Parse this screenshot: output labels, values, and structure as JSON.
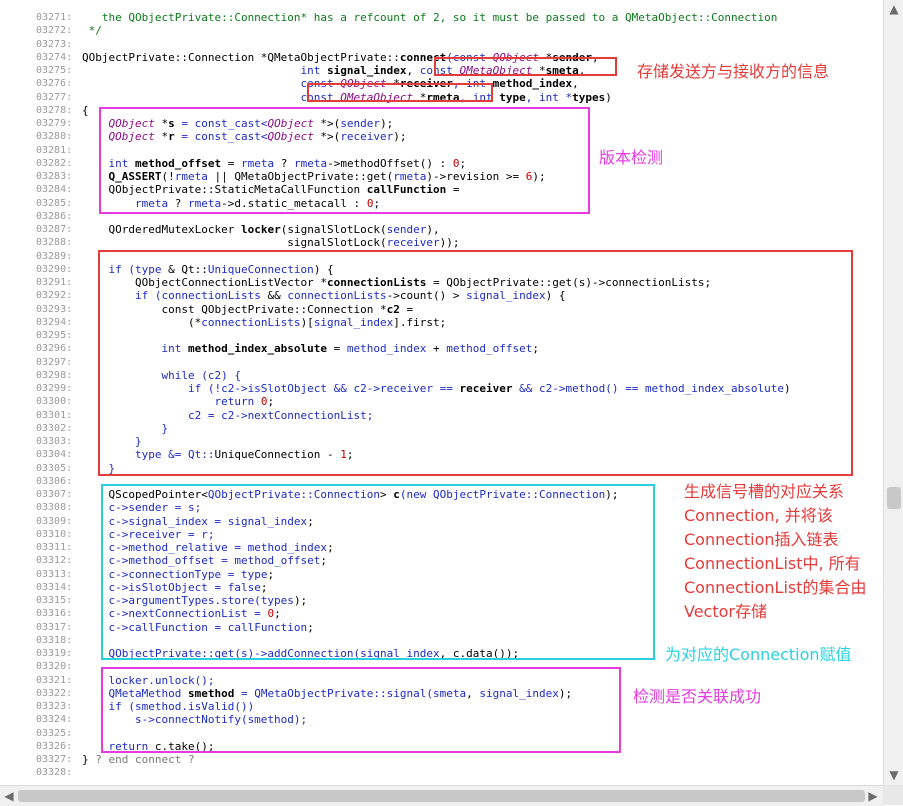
{
  "code_lines": [
    {
      "ln": "03271:",
      "segments": [
        {
          "t": "   the QObjectPrivate::Connection* has a refcount of 2, so it must be passed to a QMetaObject::Connection",
          "c": "cm"
        }
      ]
    },
    {
      "ln": "03272:",
      "segments": [
        {
          "t": " */",
          "c": "cm"
        }
      ]
    },
    {
      "ln": "03273:",
      "segments": []
    },
    {
      "ln": "03274:",
      "segments": [
        {
          "t": "QObjectPrivate::Connection *QMetaObjectPrivate::",
          "c": "id"
        },
        {
          "t": "connect",
          "c": "fn"
        },
        {
          "t": "(const ",
          "c": "kw"
        },
        {
          "t": "QObject",
          "c": "ty"
        },
        {
          "t": " *",
          "c": "id"
        },
        {
          "t": "sender",
          "c": "fn"
        },
        {
          "t": ",",
          "c": "id"
        }
      ]
    },
    {
      "ln": "03275:",
      "segments": [
        {
          "t": "                                 int ",
          "c": "kw"
        },
        {
          "t": "signal_index",
          "c": "fn"
        },
        {
          "t": ", ",
          "c": "id"
        },
        {
          "t": "const ",
          "c": "kw"
        },
        {
          "t": "QMetaObject",
          "c": "ty"
        },
        {
          "t": " *",
          "c": "id"
        },
        {
          "t": "smeta",
          "c": "fn"
        },
        {
          "t": ",",
          "c": "id"
        }
      ]
    },
    {
      "ln": "03276:",
      "segments": [
        {
          "t": "                                 const ",
          "c": "kw"
        },
        {
          "t": "QObject",
          "c": "ty"
        },
        {
          "t": " *",
          "c": "id"
        },
        {
          "t": "receiver",
          "c": "fn"
        },
        {
          "t": ", int ",
          "c": "kw"
        },
        {
          "t": "method_index",
          "c": "fn"
        },
        {
          "t": ",",
          "c": "id"
        }
      ]
    },
    {
      "ln": "03277:",
      "segments": [
        {
          "t": "                                 const ",
          "c": "kw"
        },
        {
          "t": "QMetaObject",
          "c": "ty"
        },
        {
          "t": " *",
          "c": "id"
        },
        {
          "t": "rmeta",
          "c": "fn"
        },
        {
          "t": ", int ",
          "c": "kw"
        },
        {
          "t": "type",
          "c": "fn"
        },
        {
          "t": ", int *",
          "c": "kw"
        },
        {
          "t": "types",
          "c": "fn"
        },
        {
          "t": ")",
          "c": "id"
        }
      ]
    },
    {
      "ln": "03278:",
      "segments": [
        {
          "t": "{",
          "c": "id"
        }
      ]
    },
    {
      "ln": "03279:",
      "segments": [
        {
          "t": "    ",
          "c": "id"
        },
        {
          "t": "QObject",
          "c": "ty"
        },
        {
          "t": " *",
          "c": "id"
        },
        {
          "t": "s",
          "c": "fn"
        },
        {
          "t": " = const_cast<",
          "c": "kw"
        },
        {
          "t": "QObject",
          "c": "ty"
        },
        {
          "t": " *>(",
          "c": "id"
        },
        {
          "t": "sender",
          "c": "kw"
        },
        {
          "t": ");",
          "c": "id"
        }
      ]
    },
    {
      "ln": "03280:",
      "segments": [
        {
          "t": "    ",
          "c": "id"
        },
        {
          "t": "QObject",
          "c": "ty"
        },
        {
          "t": " *",
          "c": "id"
        },
        {
          "t": "r",
          "c": "fn"
        },
        {
          "t": " = const_cast<",
          "c": "kw"
        },
        {
          "t": "QObject",
          "c": "ty"
        },
        {
          "t": " *>(",
          "c": "id"
        },
        {
          "t": "receiver",
          "c": "kw"
        },
        {
          "t": ");",
          "c": "id"
        }
      ]
    },
    {
      "ln": "03281:",
      "segments": []
    },
    {
      "ln": "03282:",
      "segments": [
        {
          "t": "    int ",
          "c": "kw"
        },
        {
          "t": "method_offset",
          "c": "fn"
        },
        {
          "t": " = ",
          "c": "id"
        },
        {
          "t": "rmeta",
          "c": "kw"
        },
        {
          "t": " ? ",
          "c": "id"
        },
        {
          "t": "rmeta",
          "c": "kw"
        },
        {
          "t": "->methodOffset() : ",
          "c": "id"
        },
        {
          "t": "0",
          "c": "num"
        },
        {
          "t": ";",
          "c": "id"
        }
      ]
    },
    {
      "ln": "03283:",
      "segments": [
        {
          "t": "    ",
          "c": "id"
        },
        {
          "t": "Q_ASSERT",
          "c": "fn"
        },
        {
          "t": "(!",
          "c": "id"
        },
        {
          "t": "rmeta",
          "c": "kw"
        },
        {
          "t": " || QMetaObjectPrivate::get(",
          "c": "id"
        },
        {
          "t": "rmeta",
          "c": "kw"
        },
        {
          "t": ")->revision >= ",
          "c": "id"
        },
        {
          "t": "6",
          "c": "num"
        },
        {
          "t": ");",
          "c": "id"
        }
      ]
    },
    {
      "ln": "03284:",
      "segments": [
        {
          "t": "    QObjectPrivate::StaticMetaCallFunction ",
          "c": "id"
        },
        {
          "t": "callFunction",
          "c": "fn"
        },
        {
          "t": " =",
          "c": "id"
        }
      ]
    },
    {
      "ln": "03285:",
      "segments": [
        {
          "t": "        ",
          "c": "id"
        },
        {
          "t": "rmeta",
          "c": "kw"
        },
        {
          "t": " ? ",
          "c": "id"
        },
        {
          "t": "rmeta",
          "c": "kw"
        },
        {
          "t": "->d.static_metacall : ",
          "c": "id"
        },
        {
          "t": "0",
          "c": "num"
        },
        {
          "t": ";",
          "c": "id"
        }
      ]
    },
    {
      "ln": "03286:",
      "segments": []
    },
    {
      "ln": "03287:",
      "segments": [
        {
          "t": "    QOrderedMutexLocker ",
          "c": "id"
        },
        {
          "t": "locker",
          "c": "fn"
        },
        {
          "t": "(signalSlotLock(",
          "c": "id"
        },
        {
          "t": "sender",
          "c": "kw"
        },
        {
          "t": "),",
          "c": "id"
        }
      ]
    },
    {
      "ln": "03288:",
      "segments": [
        {
          "t": "                               signalSlotLock(",
          "c": "id"
        },
        {
          "t": "receiver",
          "c": "kw"
        },
        {
          "t": "));",
          "c": "id"
        }
      ]
    },
    {
      "ln": "03289:",
      "segments": []
    },
    {
      "ln": "03290:",
      "segments": [
        {
          "t": "    if (",
          "c": "kw"
        },
        {
          "t": "type",
          "c": "kw"
        },
        {
          "t": " & Qt::",
          "c": "id"
        },
        {
          "t": "UniqueConnection",
          "c": "kw"
        },
        {
          "t": ") {",
          "c": "id"
        }
      ]
    },
    {
      "ln": "03291:",
      "segments": [
        {
          "t": "        QObjectConnectionListVector *",
          "c": "id"
        },
        {
          "t": "connectionLists",
          "c": "fn"
        },
        {
          "t": " = QObjectPrivate::get(s)->connectionLists;",
          "c": "id"
        }
      ]
    },
    {
      "ln": "03292:",
      "segments": [
        {
          "t": "        if (",
          "c": "kw"
        },
        {
          "t": "connectionLists",
          "c": "kw"
        },
        {
          "t": " && ",
          "c": "id"
        },
        {
          "t": "connectionLists",
          "c": "kw"
        },
        {
          "t": "->count() > ",
          "c": "id"
        },
        {
          "t": "signal_index",
          "c": "kw"
        },
        {
          "t": ") {",
          "c": "id"
        }
      ]
    },
    {
      "ln": "03293:",
      "segments": [
        {
          "t": "            const QObjectPrivate::Connection *",
          "c": "id"
        },
        {
          "t": "c2",
          "c": "fn"
        },
        {
          "t": " =",
          "c": "id"
        }
      ]
    },
    {
      "ln": "03294:",
      "segments": [
        {
          "t": "                (*",
          "c": "id"
        },
        {
          "t": "connectionLists",
          "c": "kw"
        },
        {
          "t": ")[",
          "c": "id"
        },
        {
          "t": "signal_index",
          "c": "kw"
        },
        {
          "t": "].first;",
          "c": "id"
        }
      ]
    },
    {
      "ln": "03295:",
      "segments": []
    },
    {
      "ln": "03296:",
      "segments": [
        {
          "t": "            int ",
          "c": "kw"
        },
        {
          "t": "method_index_absolute",
          "c": "fn"
        },
        {
          "t": " = ",
          "c": "id"
        },
        {
          "t": "method_index",
          "c": "kw"
        },
        {
          "t": " + ",
          "c": "id"
        },
        {
          "t": "method_offset",
          "c": "kw"
        },
        {
          "t": ";",
          "c": "id"
        }
      ]
    },
    {
      "ln": "03297:",
      "segments": []
    },
    {
      "ln": "03298:",
      "segments": [
        {
          "t": "            while (c2) {",
          "c": "kw"
        }
      ]
    },
    {
      "ln": "03299:",
      "segments": [
        {
          "t": "                if (!c2->isSlotObject && c2->receiver == ",
          "c": "kw"
        },
        {
          "t": "receiver",
          "c": "fn"
        },
        {
          "t": " && c2->method() == ",
          "c": "kw"
        },
        {
          "t": "method_index_absolute",
          "c": "kw"
        },
        {
          "t": ")",
          "c": "id"
        }
      ]
    },
    {
      "ln": "03300:",
      "segments": [
        {
          "t": "                    return ",
          "c": "kw"
        },
        {
          "t": "0",
          "c": "num"
        },
        {
          "t": ";",
          "c": "id"
        }
      ]
    },
    {
      "ln": "03301:",
      "segments": [
        {
          "t": "                c2 = c2->nextConnectionList;",
          "c": "kw"
        }
      ]
    },
    {
      "ln": "03302:",
      "segments": [
        {
          "t": "            }",
          "c": "kw"
        }
      ]
    },
    {
      "ln": "03303:",
      "segments": [
        {
          "t": "        }",
          "c": "kw"
        }
      ]
    },
    {
      "ln": "03304:",
      "segments": [
        {
          "t": "        type &= Qt::",
          "c": "kw"
        },
        {
          "t": "UniqueConnection",
          "c": "id"
        },
        {
          "t": " - ",
          "c": "id"
        },
        {
          "t": "1",
          "c": "num"
        },
        {
          "t": ";",
          "c": "id"
        }
      ]
    },
    {
      "ln": "03305:",
      "segments": [
        {
          "t": "    }",
          "c": "kw"
        }
      ]
    },
    {
      "ln": "03306:",
      "segments": []
    },
    {
      "ln": "03307:",
      "segments": [
        {
          "t": "    QScopedPointer<",
          "c": "id"
        },
        {
          "t": "QObjectPrivate::Connection",
          "c": "kw"
        },
        {
          "t": "> ",
          "c": "id"
        },
        {
          "t": "c",
          "c": "fn"
        },
        {
          "t": "(new ",
          "c": "kw"
        },
        {
          "t": "QObjectPrivate::Connection",
          "c": "kw"
        },
        {
          "t": ");",
          "c": "id"
        }
      ]
    },
    {
      "ln": "03308:",
      "segments": [
        {
          "t": "    c->sender = s;",
          "c": "kw"
        }
      ]
    },
    {
      "ln": "03309:",
      "segments": [
        {
          "t": "    c->signal_index = ",
          "c": "kw"
        },
        {
          "t": "signal_index",
          "c": "kw"
        },
        {
          "t": ";",
          "c": "id"
        }
      ]
    },
    {
      "ln": "03310:",
      "segments": [
        {
          "t": "    c->receiver = r;",
          "c": "kw"
        }
      ]
    },
    {
      "ln": "03311:",
      "segments": [
        {
          "t": "    c->method_relative = ",
          "c": "kw"
        },
        {
          "t": "method_index",
          "c": "kw"
        },
        {
          "t": ";",
          "c": "id"
        }
      ]
    },
    {
      "ln": "03312:",
      "segments": [
        {
          "t": "    c->method_offset = ",
          "c": "kw"
        },
        {
          "t": "method_offset",
          "c": "kw"
        },
        {
          "t": ";",
          "c": "id"
        }
      ]
    },
    {
      "ln": "03313:",
      "segments": [
        {
          "t": "    c->connectionType = ",
          "c": "kw"
        },
        {
          "t": "type",
          "c": "kw"
        },
        {
          "t": ";",
          "c": "id"
        }
      ]
    },
    {
      "ln": "03314:",
      "segments": [
        {
          "t": "    c->isSlotObject = ",
          "c": "kw"
        },
        {
          "t": "false",
          "c": "kw"
        },
        {
          "t": ";",
          "c": "id"
        }
      ]
    },
    {
      "ln": "03315:",
      "segments": [
        {
          "t": "    c->argumentTypes.store(",
          "c": "kw"
        },
        {
          "t": "types",
          "c": "kw"
        },
        {
          "t": ");",
          "c": "id"
        }
      ]
    },
    {
      "ln": "03316:",
      "segments": [
        {
          "t": "    c->nextConnectionList = ",
          "c": "kw"
        },
        {
          "t": "0",
          "c": "num"
        },
        {
          "t": ";",
          "c": "id"
        }
      ]
    },
    {
      "ln": "03317:",
      "segments": [
        {
          "t": "    c->callFunction = ",
          "c": "kw"
        },
        {
          "t": "callFunction",
          "c": "kw"
        },
        {
          "t": ";",
          "c": "id"
        }
      ]
    },
    {
      "ln": "03318:",
      "segments": []
    },
    {
      "ln": "03319:",
      "segments": [
        {
          "t": "    QObjectPrivate::get(s)->addConnection(",
          "c": "kw"
        },
        {
          "t": "signal_index",
          "c": "kw"
        },
        {
          "t": ", c.data());",
          "c": "id"
        }
      ]
    },
    {
      "ln": "03320:",
      "segments": []
    },
    {
      "ln": "03321:",
      "segments": [
        {
          "t": "    locker.unlock();",
          "c": "kw"
        }
      ]
    },
    {
      "ln": "03322:",
      "segments": [
        {
          "t": "    QMetaMethod ",
          "c": "kw"
        },
        {
          "t": "smethod",
          "c": "fn"
        },
        {
          "t": " = QMetaObjectPrivate::signal(",
          "c": "kw"
        },
        {
          "t": "smeta",
          "c": "kw"
        },
        {
          "t": ", ",
          "c": "id"
        },
        {
          "t": "signal_index",
          "c": "kw"
        },
        {
          "t": ");",
          "c": "id"
        }
      ]
    },
    {
      "ln": "03323:",
      "segments": [
        {
          "t": "    if (smethod.isValid())",
          "c": "kw"
        }
      ]
    },
    {
      "ln": "03324:",
      "segments": [
        {
          "t": "        s->connectNotify(smethod);",
          "c": "kw"
        }
      ]
    },
    {
      "ln": "03325:",
      "segments": []
    },
    {
      "ln": "03326:",
      "segments": [
        {
          "t": "    return ",
          "c": "kw"
        },
        {
          "t": "c.take();",
          "c": "id"
        }
      ]
    },
    {
      "ln": "03327:",
      "segments": [
        {
          "t": "} ",
          "c": "id"
        },
        {
          "t": "? end connect ?",
          "c": "muted"
        }
      ]
    },
    {
      "ln": "03328:",
      "segments": []
    }
  ],
  "annotations": {
    "params_note": "存储发送方与接收方的信息",
    "version_note": "版本检测",
    "connection_note_lines": [
      "生成信号槽的对应关系",
      "Connection, 并将该",
      "Connection插入链表",
      "ConnectionList中, 所有",
      "ConnectionList的集合由",
      "Vector存储"
    ],
    "assign_note": "为对应的Connection赋值",
    "check_note": "检测是否关联成功"
  },
  "colors": {
    "red": "#e43b3b",
    "magenta": "#e43ce0",
    "cyan": "#2bd0e0"
  },
  "scrollbars": {
    "up_arrow": "▲",
    "down_arrow": "▼",
    "left_arrow": "◀",
    "right_arrow": "▶"
  }
}
